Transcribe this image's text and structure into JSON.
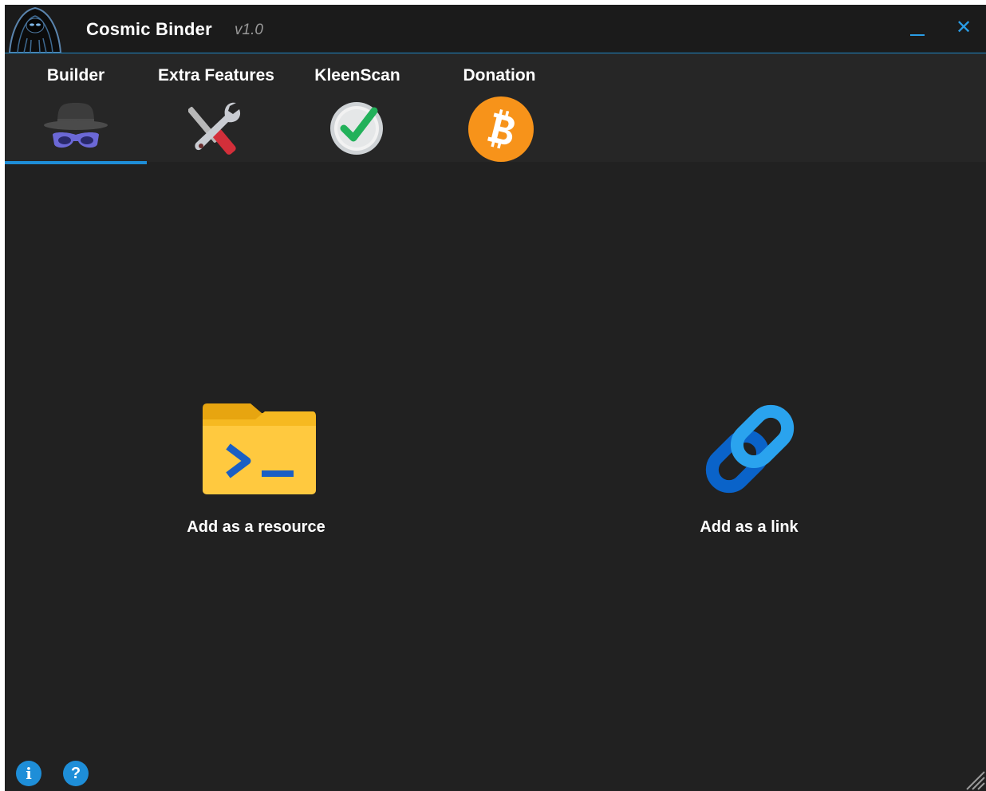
{
  "window": {
    "title": "Cosmic Binder",
    "version": "v1.0",
    "minimize_icon": "minimize-icon",
    "close_symbol": "✕"
  },
  "tabs": [
    {
      "label": "Builder",
      "icon": "incognito-hat-icon",
      "selected": true
    },
    {
      "label": "Extra Features",
      "icon": "tools-icon",
      "selected": false
    },
    {
      "label": "KleenScan",
      "icon": "check-clock-icon",
      "selected": false
    },
    {
      "label": "Donation",
      "icon": "bitcoin-icon",
      "selected": false
    }
  ],
  "actions": {
    "resource": {
      "label": "Add as a resource",
      "icon": "terminal-folder-icon"
    },
    "link": {
      "label": "Add as a link",
      "icon": "chain-link-icon"
    }
  },
  "footer": {
    "info_symbol": "i",
    "help_symbol": "?"
  },
  "colors": {
    "accent": "#1e8ed8",
    "background": "#212121",
    "titlebar": "#1b1b1b",
    "tabbar": "#262626",
    "bitcoin": "#f7931a"
  }
}
